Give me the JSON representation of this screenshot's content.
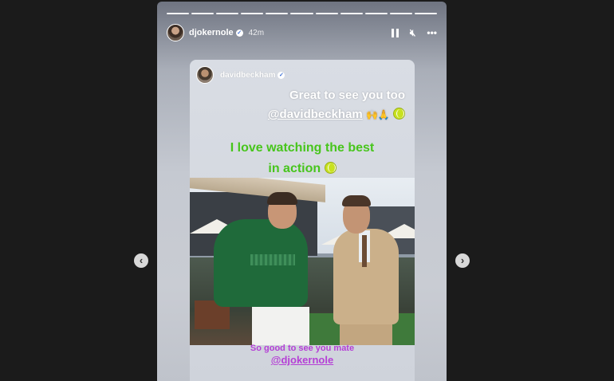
{
  "viewer": {
    "prev_icon": "chevron-left-icon",
    "next_icon": "chevron-right-icon",
    "prev_glyph": "‹",
    "next_glyph": "›"
  },
  "story": {
    "progress_segments_total": 11,
    "progress_segments_viewed": 11,
    "header": {
      "username": "djokernole",
      "verified_glyph": "✓",
      "time": "42m",
      "controls": [
        "pause-icon",
        "mute-icon",
        "more-icon"
      ],
      "mute_glyph": "🔇︎",
      "more_glyph": "•••"
    },
    "repost": {
      "original_username": "davidbeckham",
      "verified_glyph": "✓",
      "caption_top_line1": "Great to see you too",
      "caption_top_mention": "@davidbeckham",
      "caption_top_emoji": "🙌🙏",
      "caption_green_line1": "I love watching the best",
      "caption_green_line2": "in action",
      "caption_bottom_line1": "So good to see you mate",
      "caption_bottom_mention": "@djokernole"
    },
    "colors": {
      "green_caption": "#47c51c",
      "purple_caption": "#b53fd6",
      "tennis_ball": "#c8e11f"
    }
  }
}
